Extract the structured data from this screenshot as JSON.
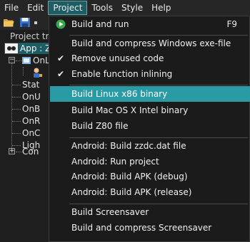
{
  "menubar": {
    "items": [
      "File",
      "Edit",
      "Project",
      "Tools",
      "Style",
      "Help"
    ]
  },
  "tree": {
    "title": "Project tre",
    "rows": [
      "App : ZA",
      "OnL",
      "Stat",
      "OnU",
      "OnB",
      "OnR",
      "OnC",
      "Ligh",
      "Con"
    ]
  },
  "menu": {
    "build_run": "Build and run",
    "build_run_shortcut": "F9",
    "build_compress_win": "Build and compress Windows exe-file",
    "remove_unused": "Remove unused code",
    "enable_inlining": "Enable function inlining",
    "build_linux": "Build Linux x86 binary",
    "build_mac": "Build Mac OS X Intel binary",
    "build_z80": "Build Z80 file",
    "android_build_dat": "Android: Build zzdc.dat file",
    "android_run": "Android: Run project",
    "android_apk_debug": "Android: Build APK (debug)",
    "android_apk_release": "Android: Build APK (release)",
    "build_screensaver": "Build Screensaver",
    "build_compress_screensaver": "Build and compress Screensaver"
  },
  "colors": {
    "menu_highlight": "#2a9aa4",
    "menubar_active": "#1f5d65",
    "background": "#1e1e1e"
  }
}
